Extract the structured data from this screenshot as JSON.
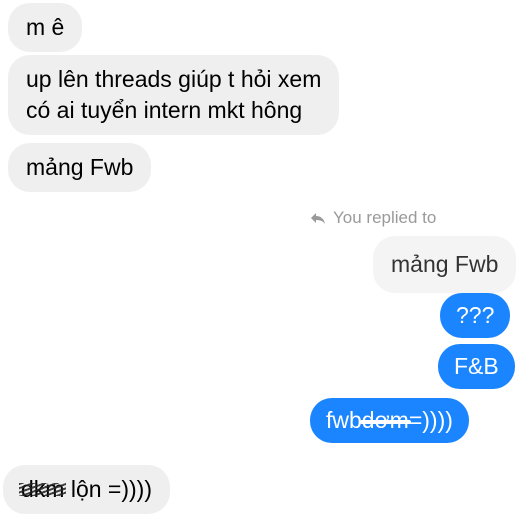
{
  "messages": {
    "m1": "m ê",
    "m2_line1": "up lên threads giúp t hỏi xem",
    "m2_line2": "có ai tuyển intern mkt hông",
    "m3": "mảng Fwb",
    "reply_indicator": "You replied to",
    "quoted": "mảng Fwb",
    "sent1": "???",
    "sent2": "F&B",
    "sent3_prefix": "fwb",
    "sent3_struck": " dơm ",
    "sent3_suffix": "=))))",
    "last_scribbled": "dkm",
    "last_text": " lộn =))))"
  },
  "icons": {
    "reply": "reply-arrow-icon"
  },
  "colors": {
    "incoming_bubble": "#efefef",
    "outgoing_bubble": "#1a85ff",
    "reply_indicator_text": "#9a9a9a"
  }
}
